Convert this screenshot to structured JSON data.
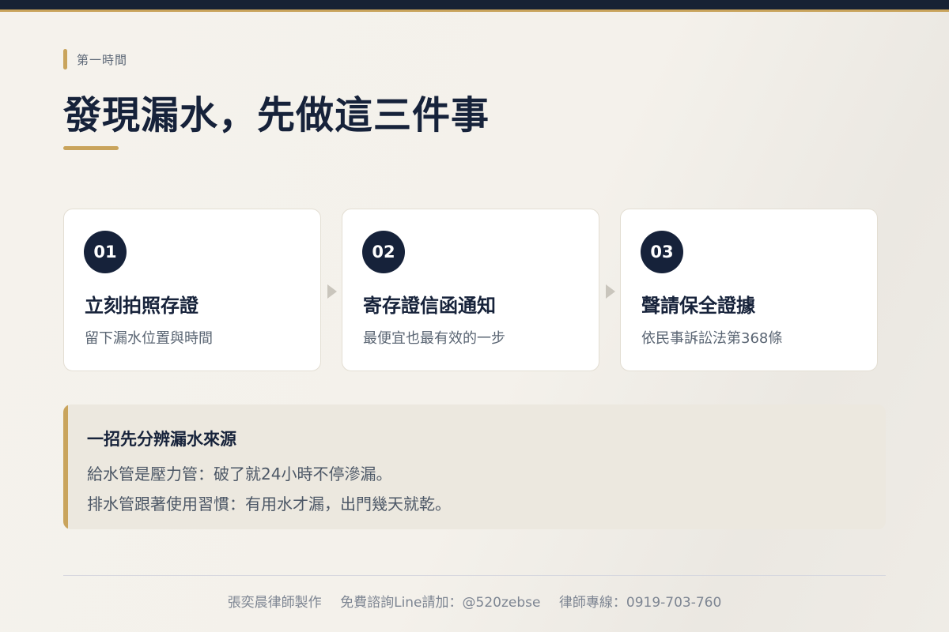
{
  "eyebrow": "第一時間",
  "title": "發現漏水，先做這三件事",
  "steps": [
    {
      "number": "01",
      "title": "立刻拍照存證",
      "description": "留下漏水位置與時間"
    },
    {
      "number": "02",
      "title": "寄存證信函通知",
      "description": "最便宜也最有效的一步"
    },
    {
      "number": "03",
      "title": "聲請保全證據",
      "description": "依民事訴訟法第368條"
    }
  ],
  "tip": {
    "heading": "一招先分辨漏水來源",
    "lines": [
      "給水管是壓力管：破了就24小時不停滲漏。",
      "排水管跟著使用習慣：有用水才漏，出門幾天就乾。"
    ]
  },
  "footer": {
    "author": "張奕晨律師製作",
    "line_contact": "免費諮詢Line請加：@520zebse",
    "phone": "律師專線：0919-703-760"
  },
  "colors": {
    "navy": "#16223a",
    "gold": "#c9a45c",
    "background": "#f4f1eb",
    "tip_background": "#ece8df"
  }
}
